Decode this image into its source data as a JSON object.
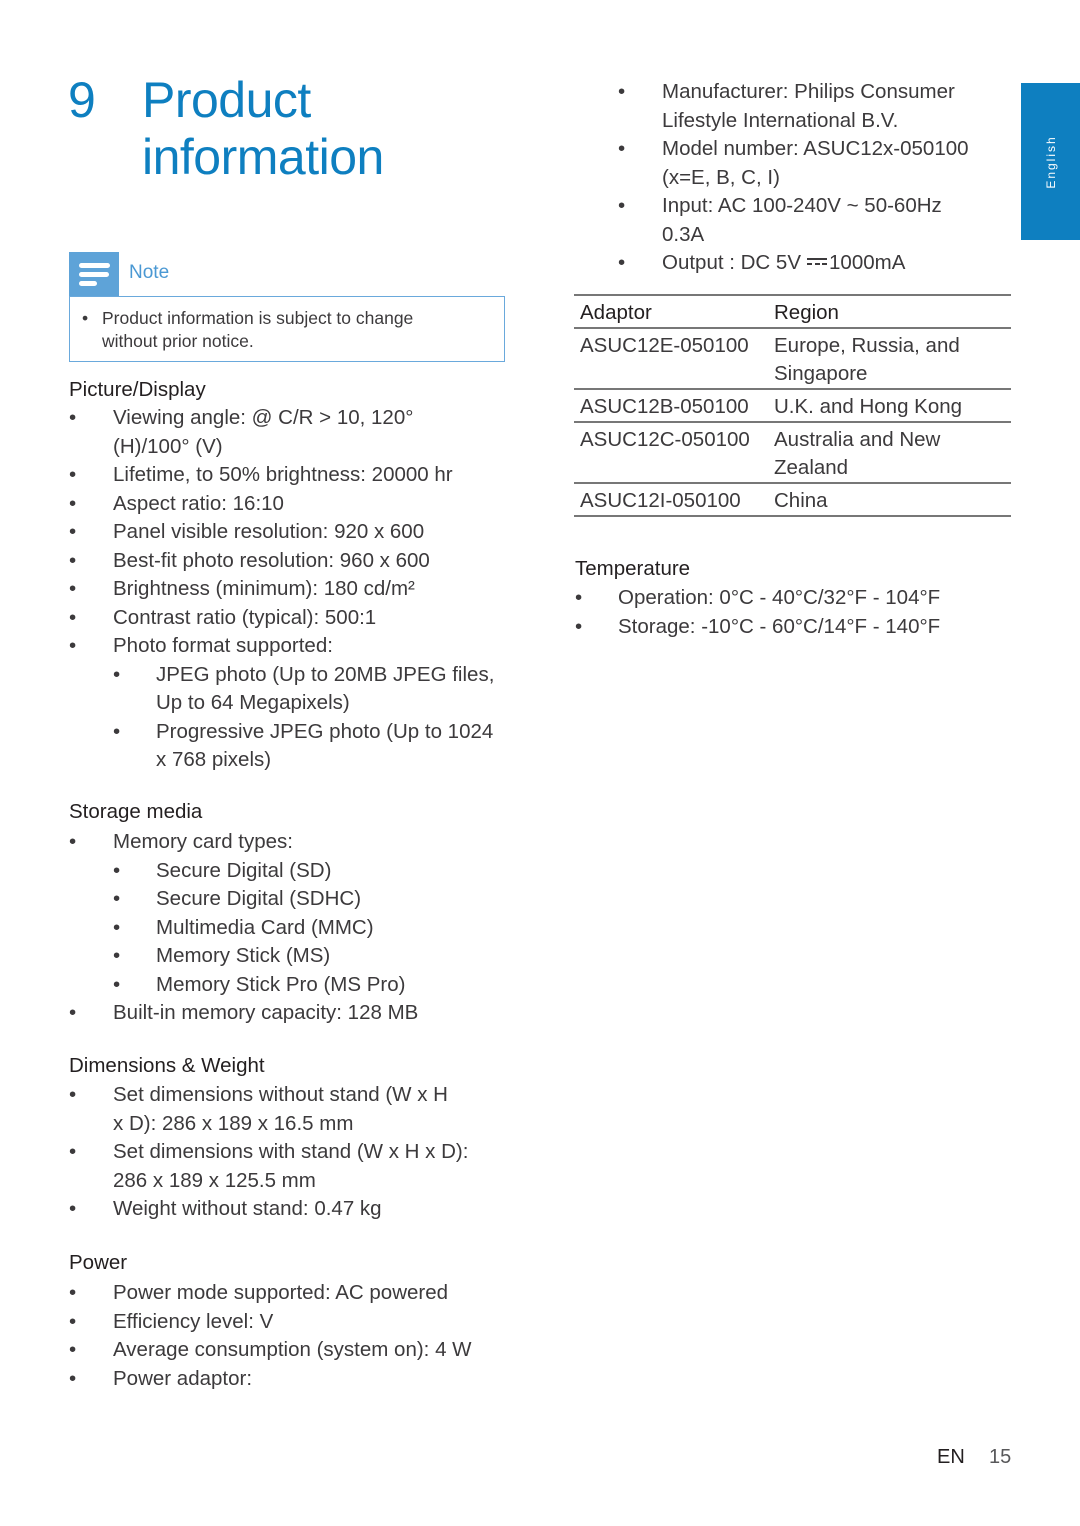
{
  "chapter": {
    "number": "9",
    "title_line1": "Product",
    "title_line2": "information"
  },
  "note": {
    "label": "Note",
    "icon": "note-lines-icon",
    "bullet": "•",
    "text": "Product information is subject to change without prior notice.",
    "text_line1": "Product information is subject to change",
    "text_line2": "without prior notice."
  },
  "bullet": "•",
  "sections": {
    "picture": {
      "heading": "Picture/Display",
      "items": [
        [
          "Viewing angle: @ C/R > 10, 120°",
          "(H)/100° (V)"
        ],
        [
          "Lifetime, to 50% brightness: 20000 hr"
        ],
        [
          "Aspect ratio: 16:10"
        ],
        [
          "Panel visible resolution: 920 x 600"
        ],
        [
          "Best-fit photo resolution: 960 x 600"
        ],
        [
          "Brightness (minimum): 180 cd/m²"
        ],
        [
          "Contrast ratio (typical): 500:1"
        ],
        [
          "Photo format supported:"
        ]
      ],
      "subitems": [
        [
          "JPEG photo (Up to 20MB JPEG files,",
          "Up to 64 Megapixels)"
        ],
        [
          "Progressive JPEG photo (Up to 1024",
          "x 768 pixels)"
        ]
      ]
    },
    "storage": {
      "heading": "Storage media",
      "item_card_types": "Memory card types:",
      "subitems": [
        "Secure Digital (SD)",
        "Secure Digital (SDHC)",
        "Multimedia Card (MMC)",
        "Memory Stick (MS)",
        "Memory Stick Pro (MS Pro)"
      ],
      "item_builtin": "Built-in memory capacity: 128 MB"
    },
    "dimensions": {
      "heading": "Dimensions & Weight",
      "items": [
        [
          "Set dimensions without stand (W x H",
          "x D): 286 x 189 x 16.5 mm"
        ],
        [
          "Set dimensions with stand (W x H x D):",
          "286 x 189 x 125.5 mm"
        ],
        [
          "Weight without stand: 0.47 kg"
        ]
      ]
    },
    "power": {
      "heading": "Power",
      "items": [
        [
          "Power mode supported: AC powered"
        ],
        [
          "Efficiency level: V"
        ],
        [
          "Average consumption (system on): 4 W"
        ],
        [
          "Power adaptor:"
        ]
      ]
    },
    "adaptor_details": {
      "items": [
        [
          "Manufacturer: Philips Consumer",
          "Lifestyle International B.V."
        ],
        [
          "Model number: ASUC12x-050100",
          "(x=E, B, C, I)"
        ],
        [
          "Input: AC 100-240V ~ 50-60Hz",
          "0.3A"
        ]
      ],
      "output_prefix": "Output : DC 5V",
      "output_symbol": "dc-current-icon",
      "output_suffix": "1000mA"
    },
    "adaptor_table": {
      "headers": [
        "Adaptor",
        "Region"
      ],
      "rows": [
        [
          "ASUC12E-050100",
          "Europe, Russia, and",
          "Singapore"
        ],
        [
          "ASUC12B-050100",
          "U.K. and Hong Kong",
          ""
        ],
        [
          "ASUC12C-050100",
          "Australia and New",
          "Zealand"
        ],
        [
          "ASUC12I-050100",
          "China",
          ""
        ]
      ]
    },
    "temperature": {
      "heading": "Temperature",
      "items": [
        "Operation: 0°C - 40°C/32°F - 104°F",
        "Storage: -10°C - 60°C/14°F - 140°F"
      ]
    }
  },
  "side_tab": {
    "label": "English"
  },
  "footer": {
    "lang": "EN",
    "page": "15"
  },
  "colors": {
    "accent": "#0e7fc0",
    "note_blue": "#5ea3d8",
    "text": "#3c3a3c"
  }
}
